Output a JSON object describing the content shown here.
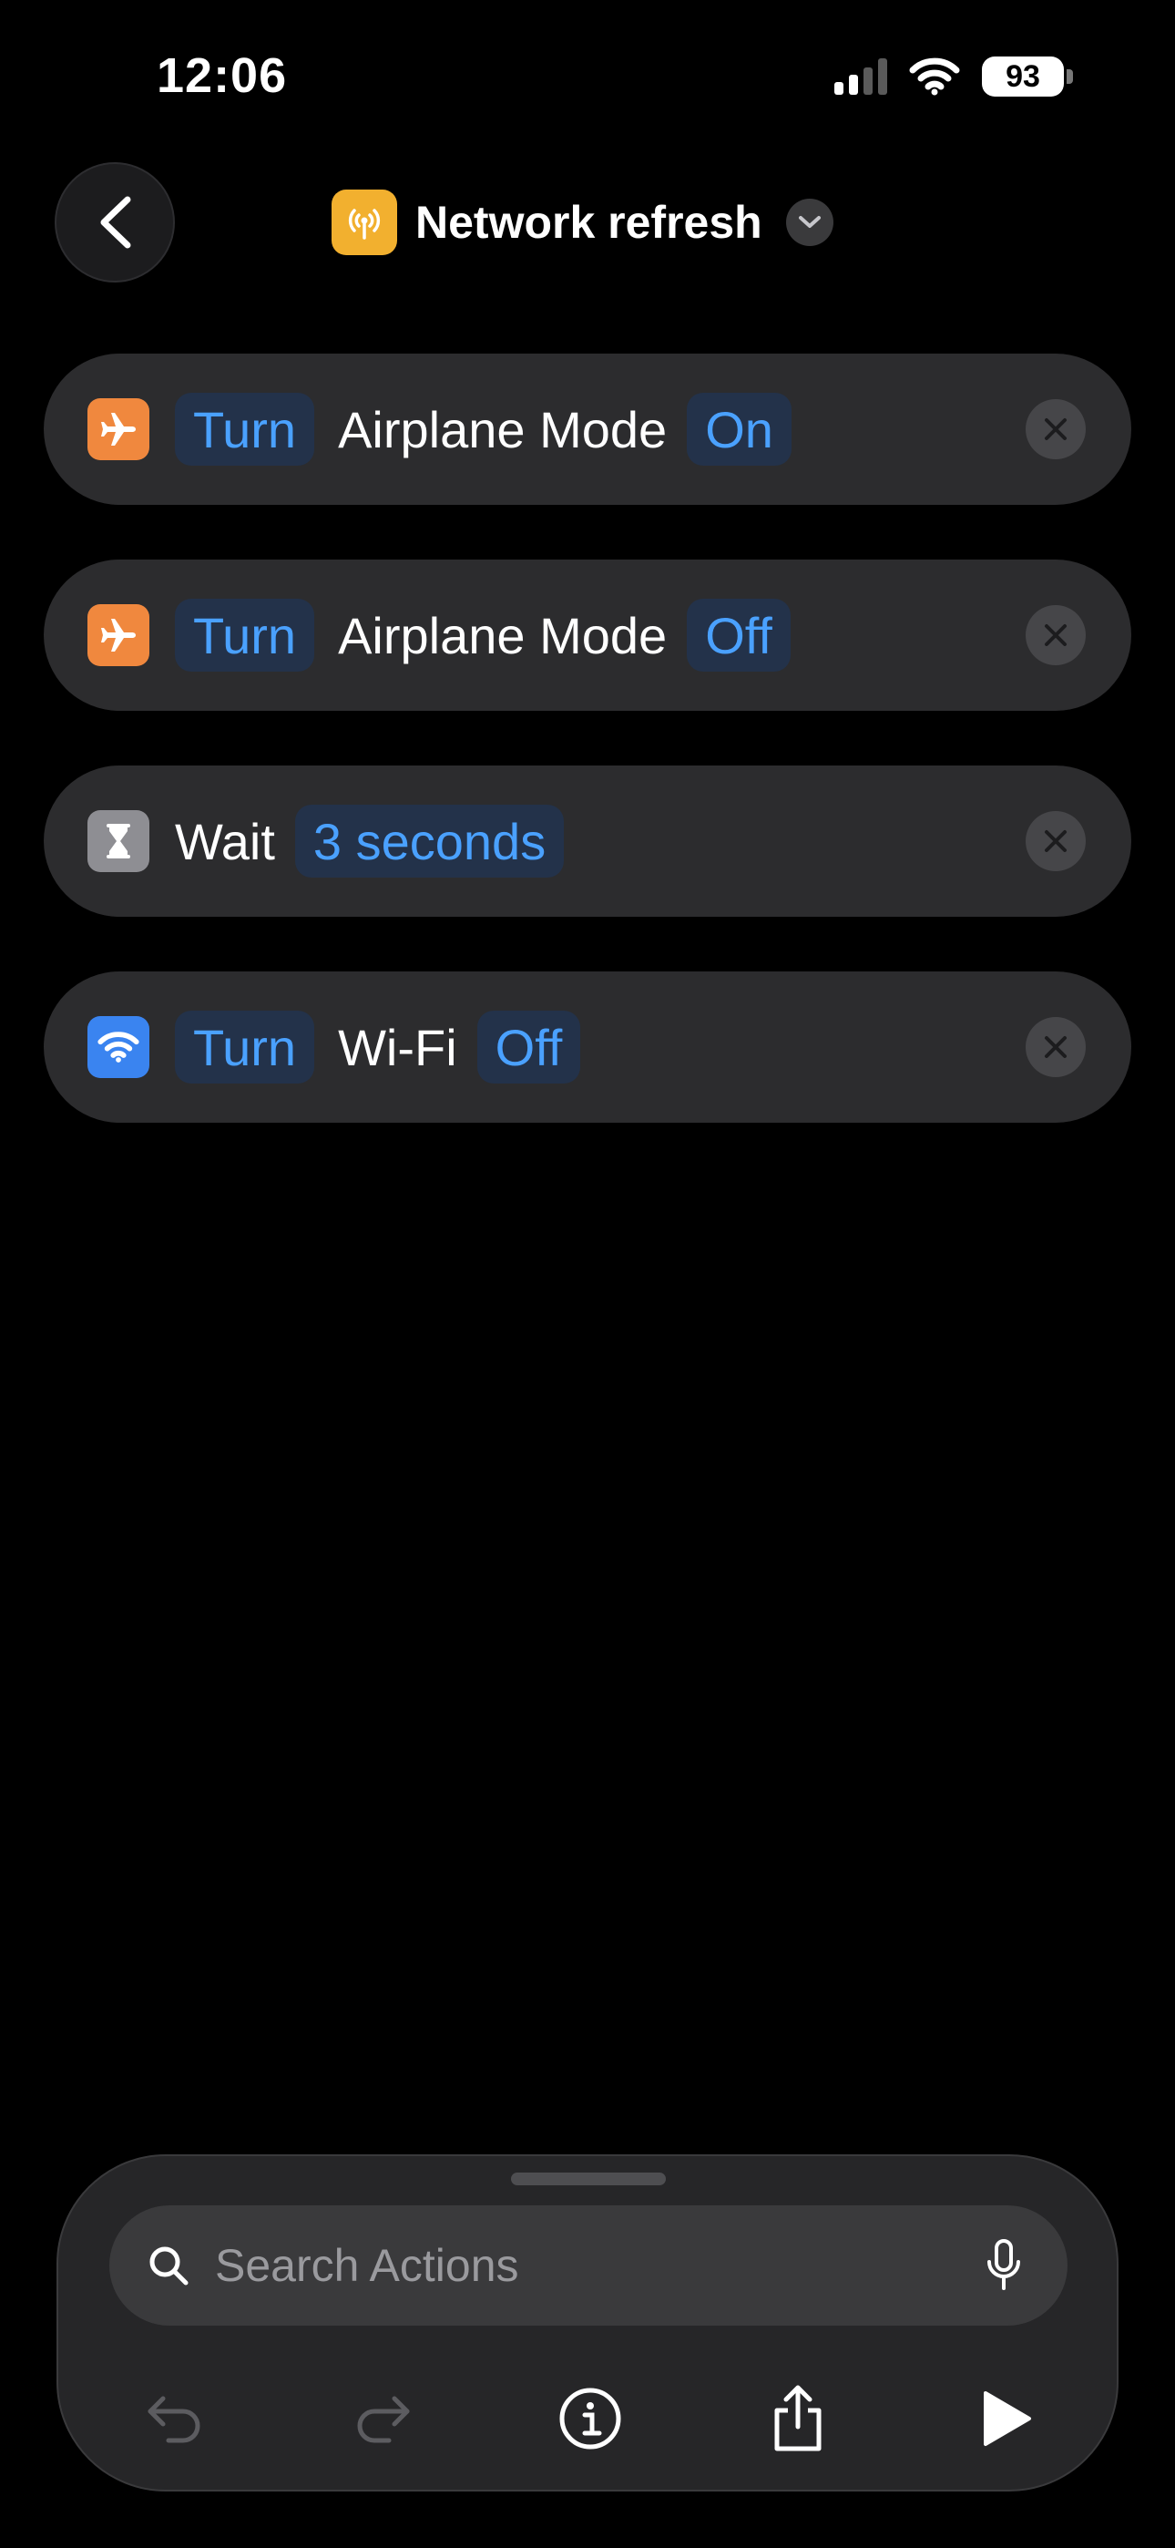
{
  "status": {
    "time": "12:06",
    "battery": "93"
  },
  "header": {
    "title": "Network refresh"
  },
  "actions": [
    {
      "verb": "Turn",
      "target": "Airplane Mode",
      "value": "On",
      "icon": "airplane-icon",
      "color": "#f0883e"
    },
    {
      "verb": "Turn",
      "target": "Airplane Mode",
      "value": "Off",
      "icon": "airplane-icon",
      "color": "#f0883e"
    },
    {
      "verb": "Wait",
      "value": "3 seconds",
      "icon": "hourglass-icon",
      "color": "#8e8e93"
    },
    {
      "verb": "Turn",
      "target": "Wi-Fi",
      "value": "Off",
      "icon": "wifi-icon",
      "color": "#3a84f0"
    }
  ],
  "search": {
    "placeholder": "Search Actions"
  },
  "colors": {
    "accent": "#4aa1ff",
    "token_bg": "#23324a",
    "card_bg": "#2c2c2e",
    "shortcut_icon": "#f2b02f"
  }
}
